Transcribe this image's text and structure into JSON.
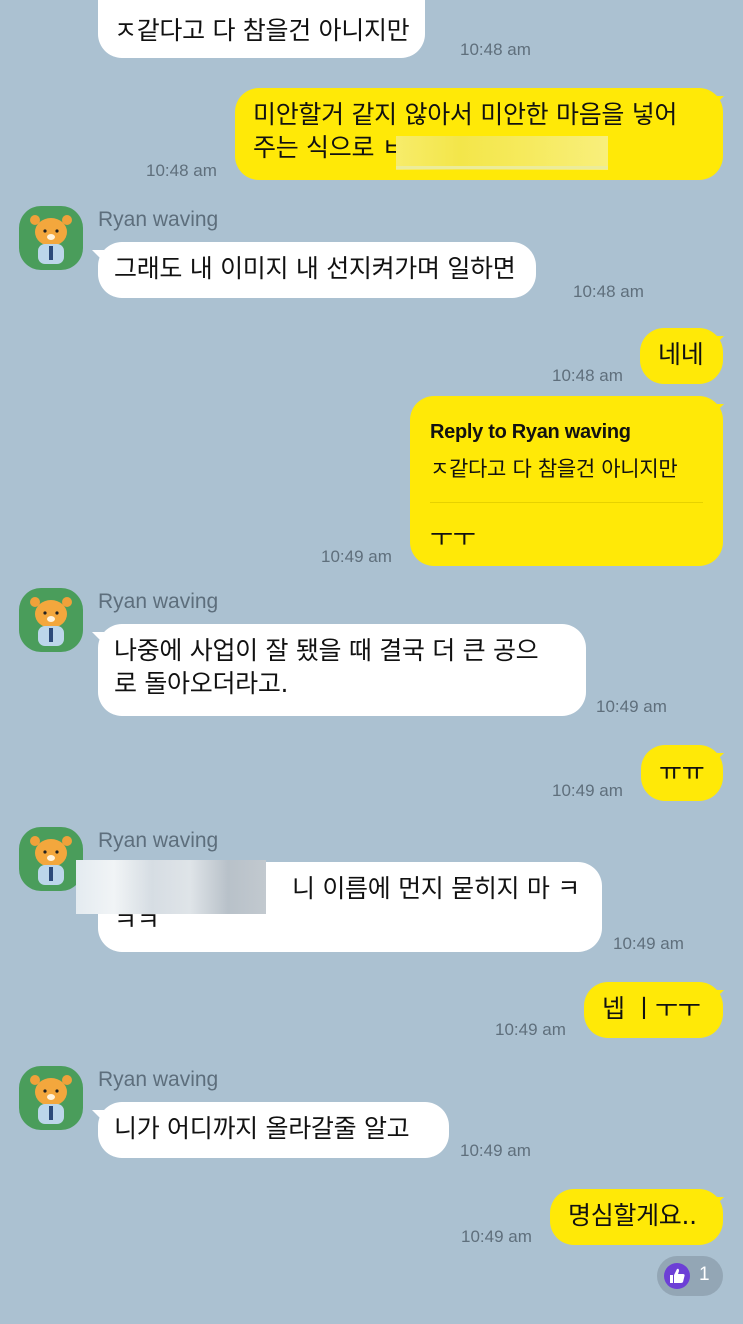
{
  "contact_name": "Ryan waving",
  "messages": [
    {
      "from": "them",
      "text": "ㅈ같다고 다 참을건 아니지만",
      "time": "10:48 am"
    },
    {
      "from": "me",
      "line1": "미안할거 같지 않아서 미안한 마음을 넣어",
      "line2": "주는 식으로 ㅂ",
      "time": "10:48 am"
    },
    {
      "from": "them",
      "text": "그래도 내 이미지 내 선지켜가며 일하면",
      "time": "10:48 am"
    },
    {
      "from": "me",
      "text": "네네",
      "time": "10:48 am"
    },
    {
      "from": "me",
      "reply_title": "Reply to Ryan waving",
      "reply_quote": "ㅈ같다고 다 참을건 아니지만",
      "text": "ㅜㅜ",
      "time": "10:49 am"
    },
    {
      "from": "them",
      "line1": "나중에 사업이 잘 됐을 때 결국 더 큰 공으",
      "line2": "로 돌아오더라고.",
      "time": "10:49 am"
    },
    {
      "from": "me",
      "text": "ㅠㅠ",
      "time": "10:49 am"
    },
    {
      "from": "them",
      "line1": "니 이름에 먼지 묻히지 마 ㅋ",
      "line2": "ㅋㅋ",
      "time": "10:49 am"
    },
    {
      "from": "me",
      "text": "넵 ㅣㅜㅜ",
      "time": "10:49 am"
    },
    {
      "from": "them",
      "text": "니가 어디까지 올라갈줄 알고",
      "time": "10:49 am"
    },
    {
      "from": "me",
      "text": "명심할게요..",
      "time": "10:49 am"
    }
  ],
  "reaction": {
    "icon": "thumbs-up-icon",
    "count": "1"
  },
  "colors": {
    "background": "#abc1d1",
    "outgoing": "#ffe907",
    "incoming": "#ffffff",
    "reaction": "#6d3fd6"
  }
}
